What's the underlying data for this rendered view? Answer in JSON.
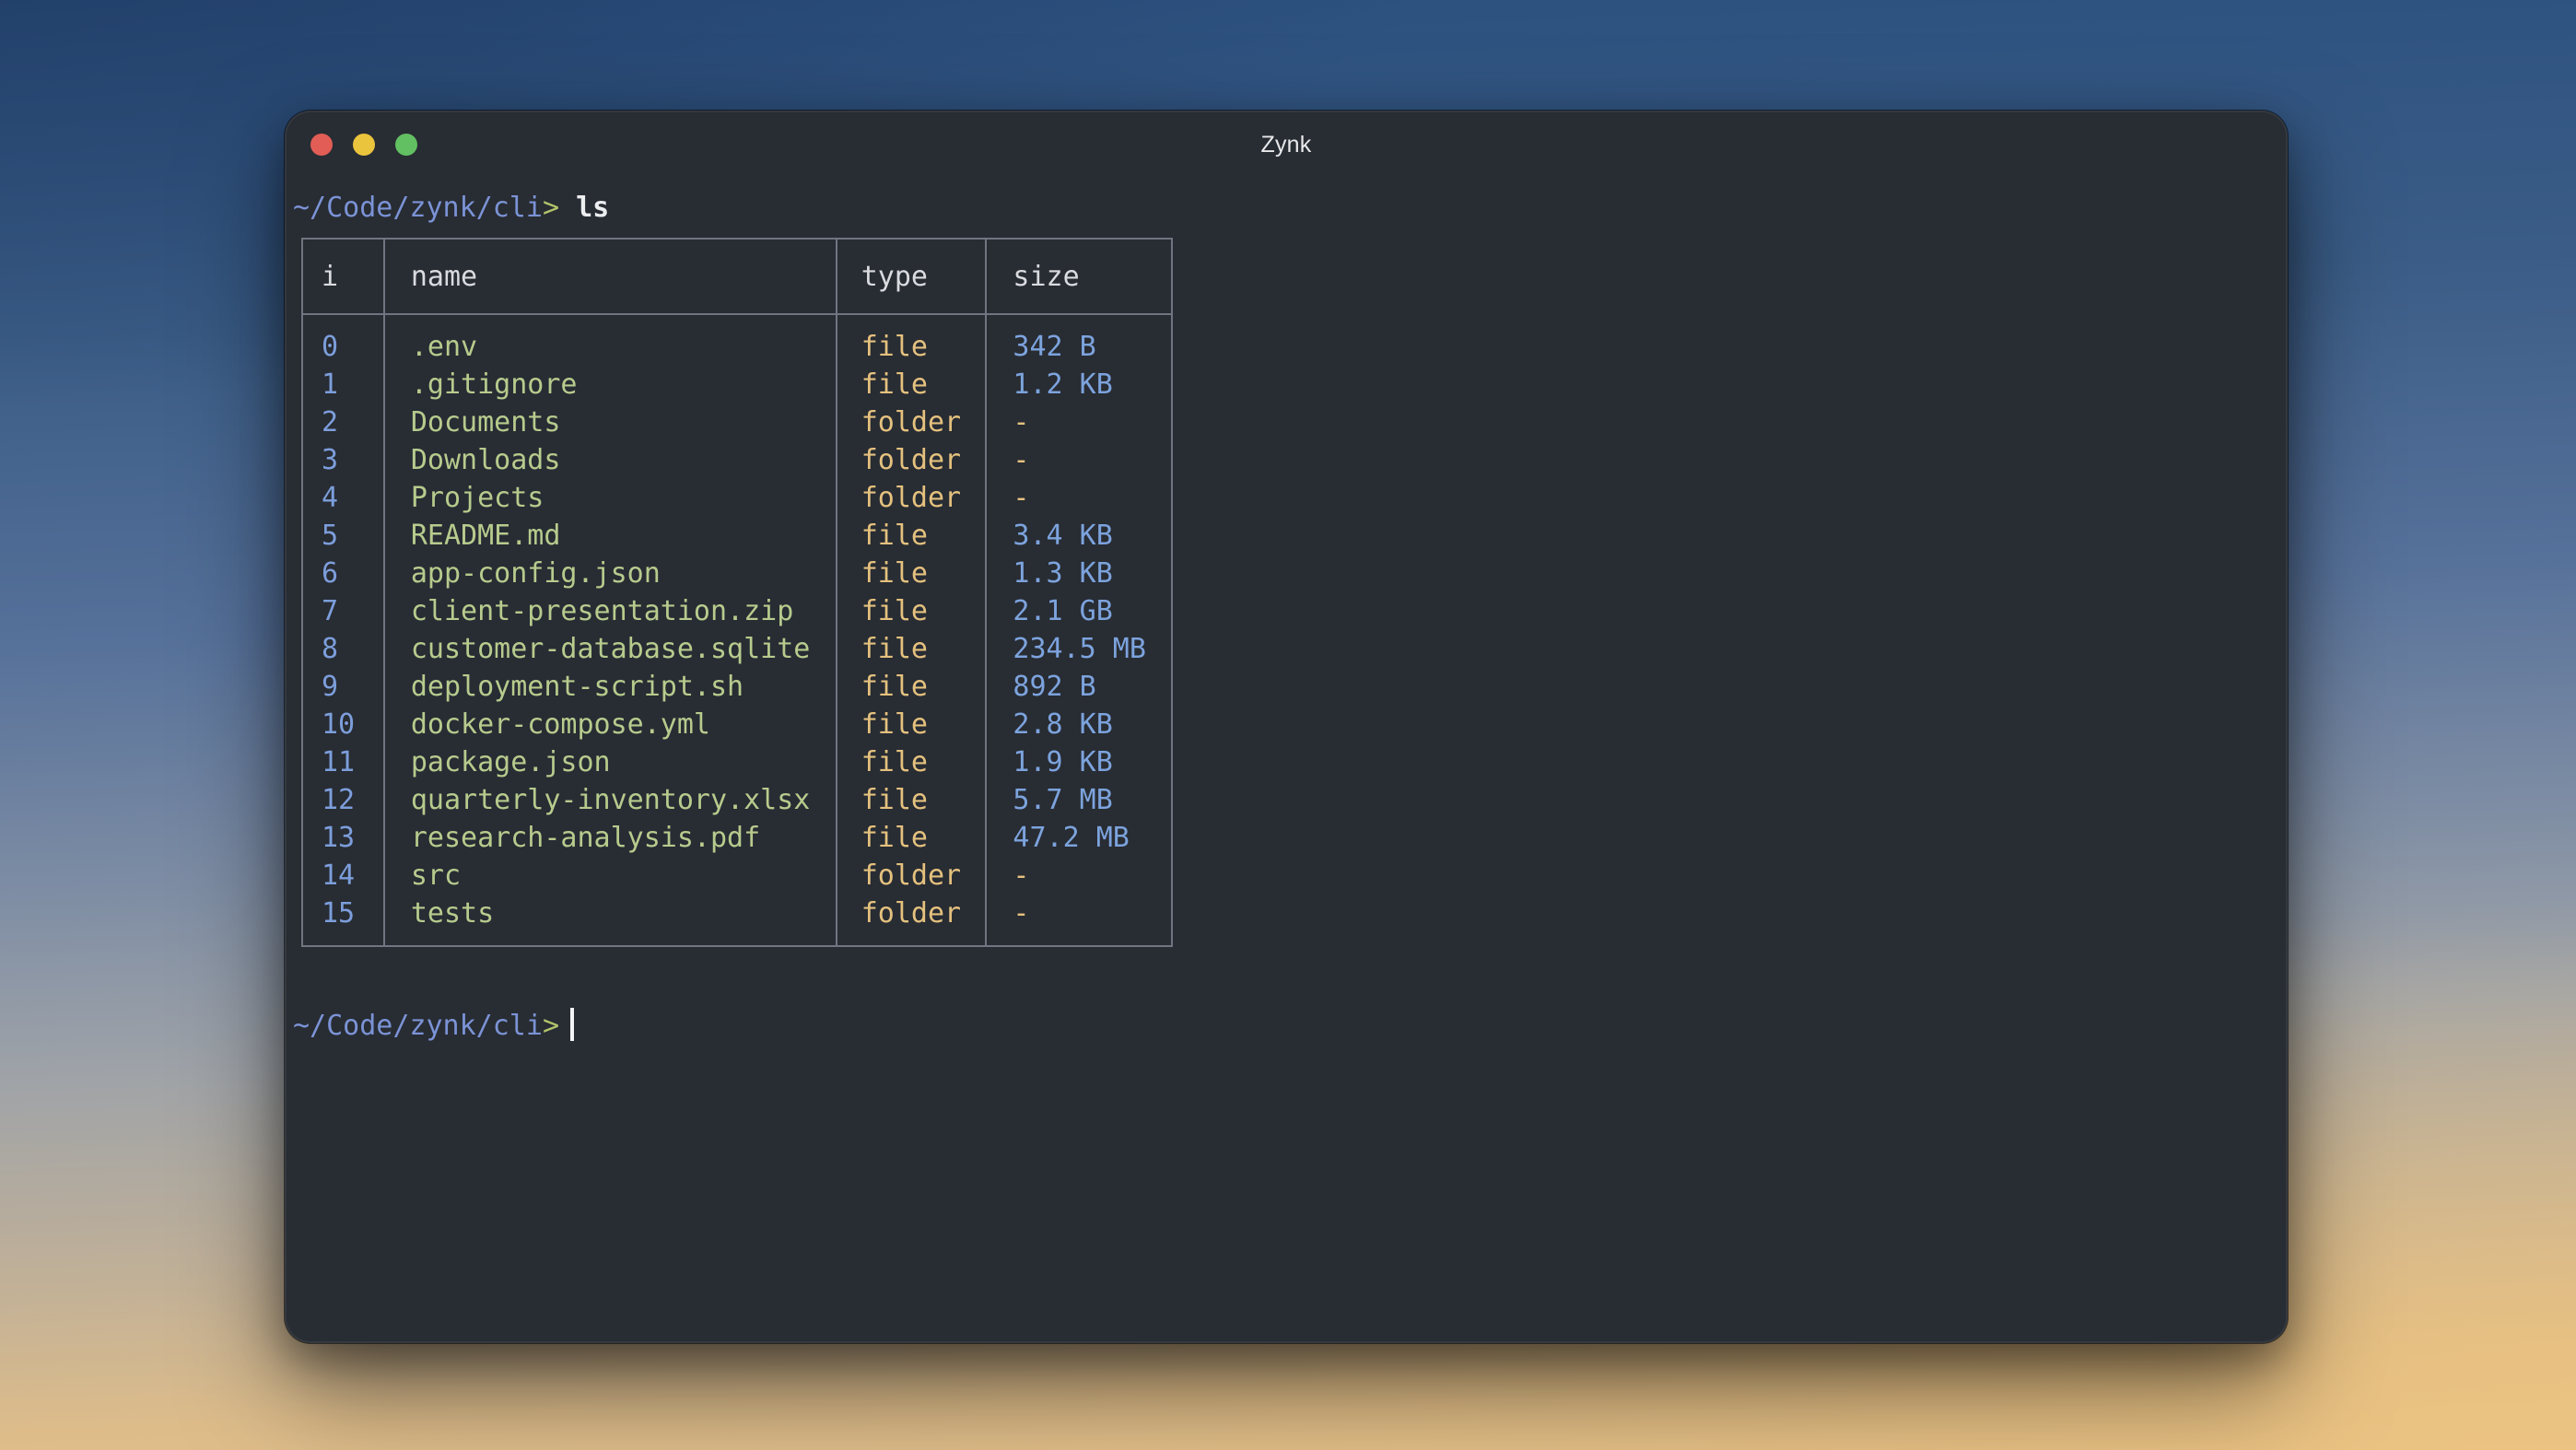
{
  "window": {
    "title": "Zynk",
    "traffic_lights": [
      "close",
      "minimize",
      "zoom"
    ]
  },
  "terminal": {
    "prompt": {
      "path": "~/Code/zynk/cli",
      "caret": ">"
    },
    "command": "ls",
    "table": {
      "headers": [
        "i",
        "name",
        "type",
        "size"
      ],
      "rows": [
        {
          "i": "0",
          "name": ".env",
          "type": "file",
          "size": "342 B"
        },
        {
          "i": "1",
          "name": ".gitignore",
          "type": "file",
          "size": "1.2 KB"
        },
        {
          "i": "2",
          "name": "Documents",
          "type": "folder",
          "size": "-"
        },
        {
          "i": "3",
          "name": "Downloads",
          "type": "folder",
          "size": "-"
        },
        {
          "i": "4",
          "name": "Projects",
          "type": "folder",
          "size": "-"
        },
        {
          "i": "5",
          "name": "README.md",
          "type": "file",
          "size": "3.4 KB"
        },
        {
          "i": "6",
          "name": "app-config.json",
          "type": "file",
          "size": "1.3 KB"
        },
        {
          "i": "7",
          "name": "client-presentation.zip",
          "type": "file",
          "size": "2.1 GB"
        },
        {
          "i": "8",
          "name": "customer-database.sqlite",
          "type": "file",
          "size": "234.5 MB"
        },
        {
          "i": "9",
          "name": "deployment-script.sh",
          "type": "file",
          "size": "892 B"
        },
        {
          "i": "10",
          "name": "docker-compose.yml",
          "type": "file",
          "size": "2.8 KB"
        },
        {
          "i": "11",
          "name": "package.json",
          "type": "file",
          "size": "1.9 KB"
        },
        {
          "i": "12",
          "name": "quarterly-inventory.xlsx",
          "type": "file",
          "size": "5.7 MB"
        },
        {
          "i": "13",
          "name": "research-analysis.pdf",
          "type": "file",
          "size": "47.2 MB"
        },
        {
          "i": "14",
          "name": "src",
          "type": "folder",
          "size": "-"
        },
        {
          "i": "15",
          "name": "tests",
          "type": "folder",
          "size": "-"
        }
      ]
    },
    "colors": {
      "terminal_background": "#282c33",
      "prompt_path_blue": "#7b93d6",
      "caret_green": "#b2c46a",
      "command_white": "#eceef0",
      "index_blue": "#7c9edb",
      "name_green": "#b7cb8d",
      "type_yellow": "#e4c17e",
      "size_blue": "#7ca3dd",
      "table_border_gray": "#6f7681",
      "traffic_red": "#e25d55",
      "traffic_yellow": "#eac43d",
      "traffic_green": "#62c062"
    }
  }
}
